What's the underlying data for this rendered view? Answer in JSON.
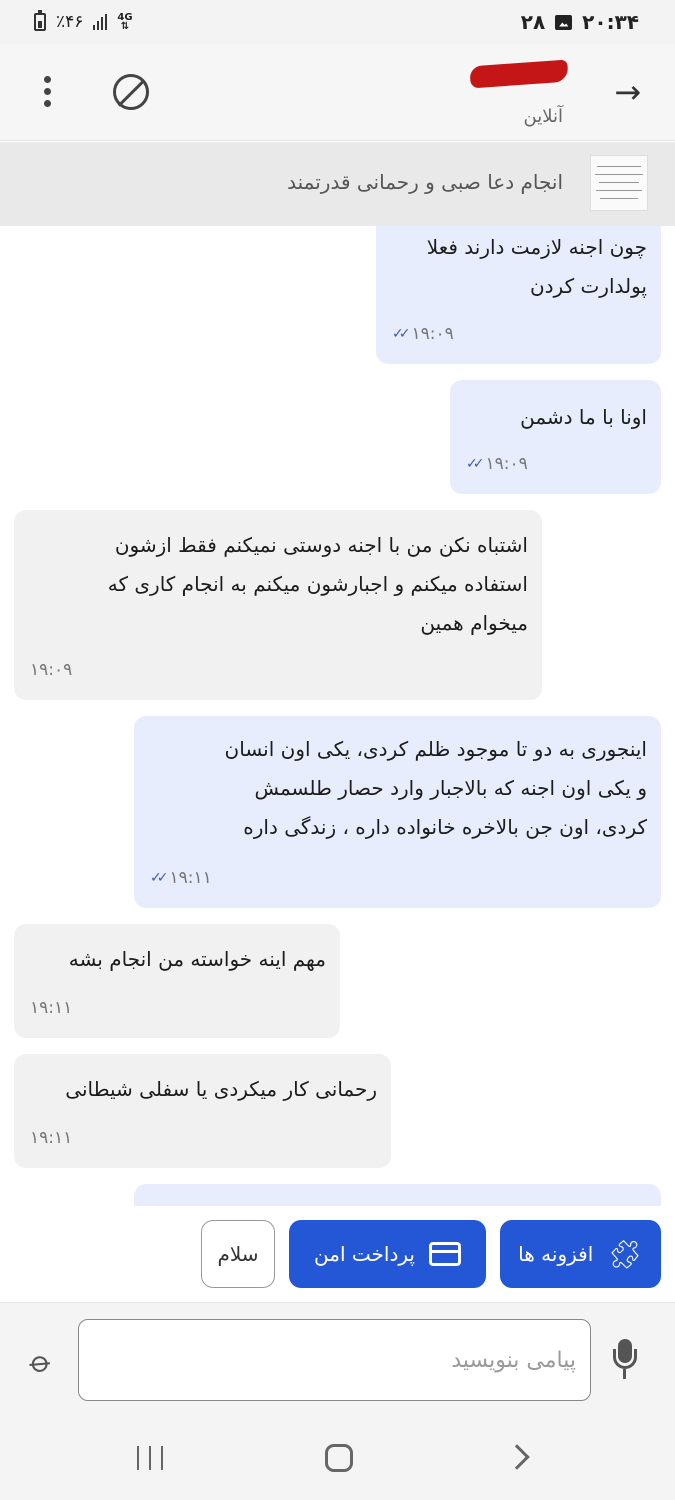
{
  "status_bar": {
    "battery": "٪۴۶",
    "network": "4G",
    "date": "۲۸",
    "time": "۲۰:۳۴"
  },
  "header": {
    "contact_status": "آنلاین"
  },
  "pinned": {
    "text": "انجام دعا صبی و رحمانی قدرتمند"
  },
  "messages": [
    {
      "lines": [
        "چون اجنه لازمت دارند فعلا",
        "پولدارت کردن"
      ],
      "time": "۱۹:۰۹"
    },
    {
      "lines": [
        "اونا با ما دشمن"
      ],
      "time": "۱۹:۰۹"
    },
    {
      "lines": [
        "اشتباه نکن من با اجنه دوستی نمیکنم فقط ازشون",
        "استفاده میکنم و اجبارشون میکنم به انجام کاری که",
        "میخوام همین"
      ],
      "time": "۱۹:۰۹"
    },
    {
      "lines": [
        "اینجوری به دو تا موجود ظلم کردی، یکی اون انسان",
        "و یکی اون اجنه که بالاجبار وارد حصار طلسمش",
        "کردی، اون جن بالاخره خانواده داره ، زندگی داره"
      ],
      "time": "۱۹:۱۱"
    },
    {
      "lines": [
        "مهم اینه خواسته من انجام بشه"
      ],
      "time": "۱۹:۱۱"
    },
    {
      "lines": [
        "رحمانی کار میکردی یا سفلی شیطانی"
      ],
      "time": "۱۹:۱۱"
    }
  ],
  "actions": {
    "addons": "افزونه ها",
    "secure_payment": "پرداخت امن",
    "greeting": "سلام"
  },
  "composer": {
    "placeholder": "پیامی بنویسید"
  },
  "icons": [
    "more-icon",
    "block-icon",
    "back-arrow-icon",
    "puzzle-icon",
    "card-icon",
    "attach-icon",
    "mic-icon"
  ],
  "colors": {
    "accent": "#2457d6",
    "outgoing_bubble": "#e8edfd",
    "incoming_bubble": "#f1f1f1",
    "read_ticks": "#3b5bb8"
  }
}
